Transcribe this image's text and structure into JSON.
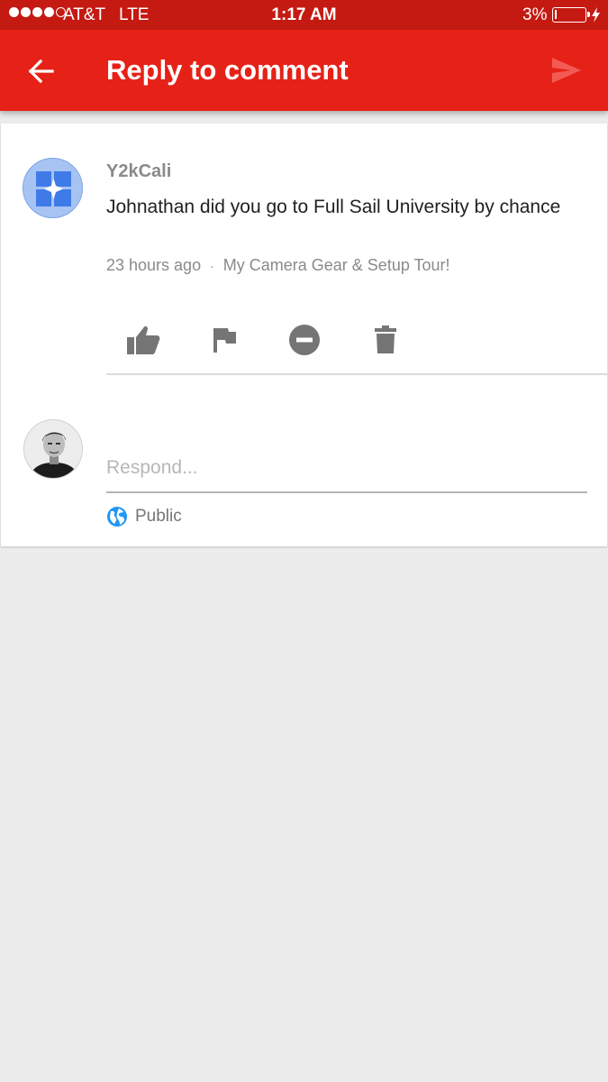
{
  "status_bar": {
    "carrier": "AT&T",
    "network": "LTE",
    "time": "1:17 AM",
    "battery_percent": "3%",
    "signal_bars_filled": 4,
    "signal_bars_total": 5
  },
  "app_bar": {
    "title": "Reply to comment",
    "back_icon": "arrow-back-icon",
    "send_icon": "send-icon",
    "color": "#e62117"
  },
  "comment": {
    "author": "Y2kCali",
    "text": "Johnathan did you go to Full Sail University by chance",
    "time_ago": "23 hours ago",
    "separator": "·",
    "video_title": "My Camera Gear & Setup Tour!",
    "actions": [
      "thumbs-up-icon",
      "flag-icon",
      "block-icon",
      "trash-icon"
    ]
  },
  "reply": {
    "placeholder": "Respond...",
    "privacy_label": "Public",
    "privacy_icon": "globe-icon"
  }
}
